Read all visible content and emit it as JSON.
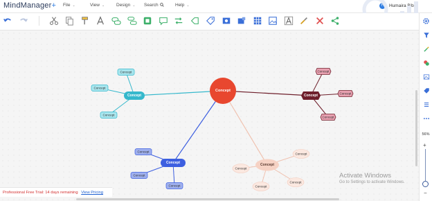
{
  "app": {
    "logo": "MindManager",
    "logo_mark": "+"
  },
  "menu": [
    {
      "label": "File",
      "has_chevron": true
    },
    {
      "label": "View",
      "has_chevron": true
    },
    {
      "label": "Design",
      "has_chevron": true
    },
    {
      "label": "Search",
      "icon": "search-icon"
    },
    {
      "label": "Help",
      "has_chevron": true
    }
  ],
  "user": {
    "initial": "H",
    "name": "Humaira Bibi"
  },
  "toolbar": [
    "undo-icon",
    "redo-icon",
    "cut-icon",
    "copy-icon",
    "format-painter-icon",
    "text-style-icon",
    "add-topic-icon",
    "add-subtopic-icon",
    "callout-icon",
    "add-image-icon",
    "comment-icon",
    "relationship-icon",
    "boundary-icon",
    "tag-icon",
    "mark-icon",
    "attachment-icon",
    "table-icon",
    "text-box-icon",
    "brush-icon",
    "delete-icon",
    "share-icon"
  ],
  "sidebar": [
    "settings-icon",
    "filter-icon",
    "brush-icon",
    "emoji-icon",
    "image-icon",
    "tag-icon",
    "list-icon",
    "more-icon"
  ],
  "zoom": {
    "label": "56%",
    "plus": "+",
    "minus": "−",
    "level_percent": 56
  },
  "mindmap": {
    "central": {
      "label": "Concept",
      "color": "#e8472f"
    },
    "branches": [
      {
        "name": "teal",
        "label": "Concept",
        "color": "#35b8cc",
        "light": "#a9e6ee",
        "children": [
          "Concept",
          "Concept",
          "Concept"
        ]
      },
      {
        "name": "maroon",
        "label": "Concept",
        "color": "#6e1f2b",
        "light": "#e8a0b0",
        "children": [
          "Concept",
          "Concept",
          "Concept"
        ]
      },
      {
        "name": "blue",
        "label": "Concept",
        "color": "#3d5fe0",
        "light": "#9fb0ee",
        "children": [
          "Concept",
          "Concept",
          "Concept"
        ]
      },
      {
        "name": "peach",
        "label": "Concept",
        "color": "#f6d2c4",
        "light": "#fbe8e0",
        "children": [
          "Concept",
          "Concept",
          "Concept",
          "Concept"
        ]
      }
    ]
  },
  "trial": {
    "text": "Professional Free Trial: 14 days remaining",
    "link": "View Pricing"
  },
  "watermark": {
    "line1": "Activate Windows",
    "line2": "Go to Settings to activate Windows."
  },
  "colors": {
    "accent": "#2f7de1",
    "trial_red": "#d32f2f"
  }
}
